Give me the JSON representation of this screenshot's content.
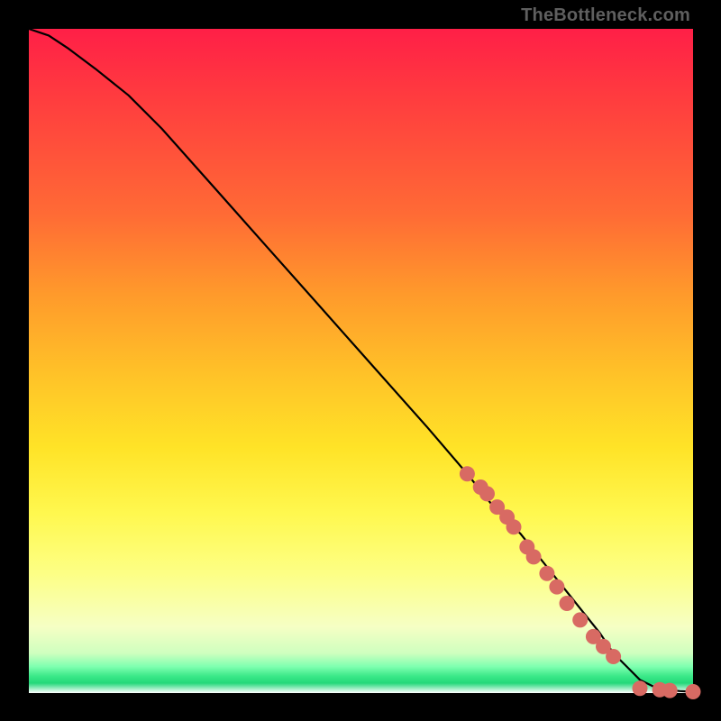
{
  "watermark": "TheBottleneck.com",
  "chart_data": {
    "type": "line",
    "title": "",
    "xlabel": "",
    "ylabel": "",
    "xlim": [
      0,
      100
    ],
    "ylim": [
      0,
      100
    ],
    "series": [
      {
        "name": "curve",
        "x": [
          0,
          3,
          6,
          10,
          15,
          20,
          28,
          36,
          44,
          52,
          60,
          66,
          70,
          74,
          78,
          82,
          86,
          88,
          90,
          92,
          94,
          96,
          98,
          100
        ],
        "y": [
          100,
          99,
          97,
          94,
          90,
          85,
          76,
          67,
          58,
          49,
          40,
          33,
          28,
          24,
          19,
          14,
          9,
          6,
          4,
          2,
          1,
          0.5,
          0.3,
          0.2
        ]
      }
    ],
    "markers": {
      "name": "highlighted-points",
      "color": "#d86a63",
      "x": [
        66,
        68,
        69,
        70.5,
        72,
        73,
        75,
        76,
        78,
        79.5,
        81,
        83,
        85,
        86.5,
        88,
        92,
        95,
        96.5,
        100
      ],
      "y": [
        33,
        31,
        30,
        28,
        26.5,
        25,
        22,
        20.5,
        18,
        16,
        13.5,
        11,
        8.5,
        7,
        5.5,
        0.7,
        0.5,
        0.4,
        0.2
      ]
    },
    "gradient_bands": [
      {
        "color": "#ff1f47",
        "stop": 0
      },
      {
        "color": "#ffc228",
        "stop": 50
      },
      {
        "color": "#fff84f",
        "stop": 75
      },
      {
        "color": "#39e887",
        "stop": 97
      },
      {
        "color": "#ffffff",
        "stop": 100
      }
    ]
  }
}
